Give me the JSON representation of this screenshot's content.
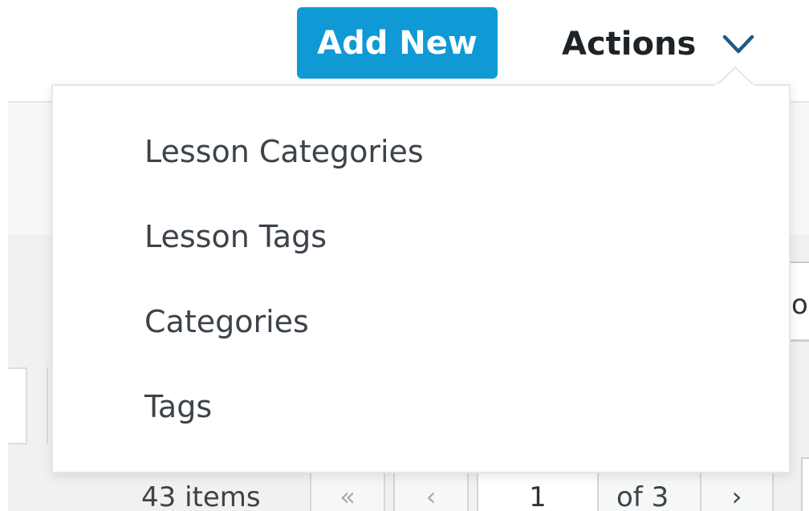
{
  "header": {
    "add_new_label": "Add New",
    "actions_label": "Actions"
  },
  "actions_menu": {
    "items": [
      {
        "label": "Lesson Categories"
      },
      {
        "label": "Lesson Tags"
      },
      {
        "label": "Categories"
      },
      {
        "label": "Tags"
      }
    ]
  },
  "background": {
    "right_field_text": "o"
  },
  "pagination": {
    "item_count": "43 items",
    "first_label": "«",
    "prev_label": "‹",
    "current_page": "1",
    "total_label": "of 3",
    "next_label": "›"
  },
  "colors": {
    "primary_button": "#0f9ad6",
    "chevron": "#1b5c86",
    "menu_text": "#3c434a"
  },
  "icons": {
    "actions_chevron": "chevron-down-icon"
  }
}
